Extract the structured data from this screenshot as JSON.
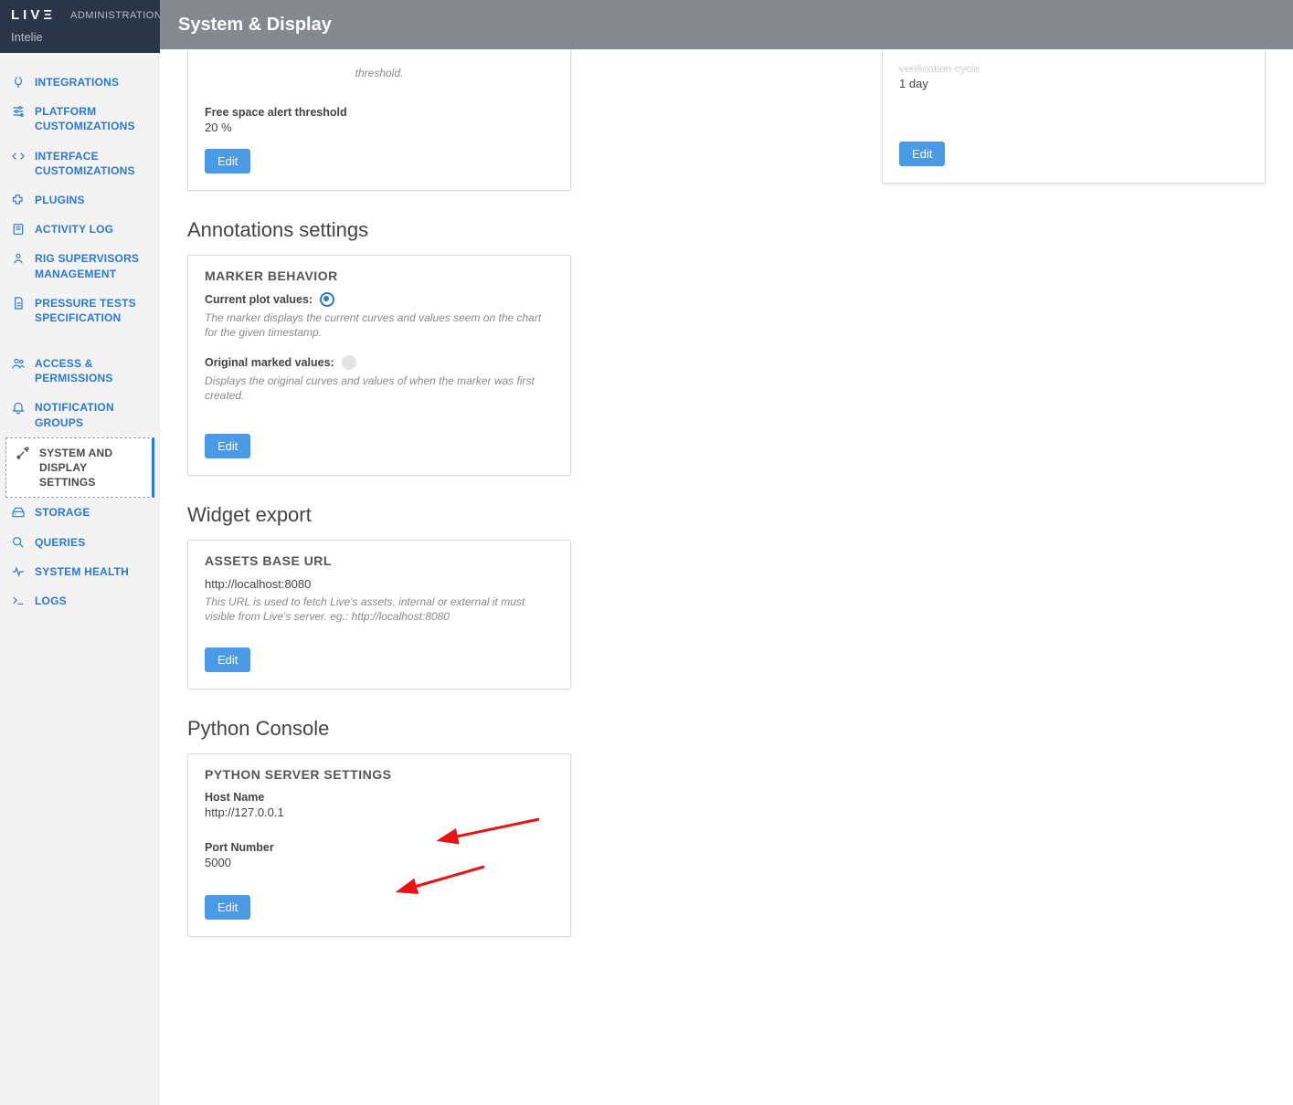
{
  "brand": {
    "logo": "LIVΞ",
    "admin": "ADMINISTRATION",
    "sub": "Intelie"
  },
  "topbar": {
    "title": "System & Display"
  },
  "sidebar": {
    "items": [
      {
        "key": "integrations",
        "label": "INTEGRATIONS"
      },
      {
        "key": "platform-customizations",
        "label": "PLATFORM CUSTOMIZATIONS"
      },
      {
        "key": "interface-customizations",
        "label": "INTERFACE CUSTOMIZATIONS"
      },
      {
        "key": "plugins",
        "label": "PLUGINS"
      },
      {
        "key": "activity-log",
        "label": "ACTIVITY LOG"
      },
      {
        "key": "rig-supervisors",
        "label": "RIG SUPERVISORS MANAGEMENT"
      },
      {
        "key": "pressure-tests",
        "label": "PRESSURE TESTS SPECIFICATION"
      }
    ],
    "items2": [
      {
        "key": "access-permissions",
        "label": "ACCESS & PERMISSIONS"
      },
      {
        "key": "notification-groups",
        "label": "NOTIFICATION GROUPS"
      },
      {
        "key": "system-display",
        "label": "SYSTEM AND DISPLAY SETTINGS"
      },
      {
        "key": "storage",
        "label": "STORAGE"
      },
      {
        "key": "queries",
        "label": "QUERIES"
      },
      {
        "key": "system-health",
        "label": "SYSTEM HEALTH"
      },
      {
        "key": "logs",
        "label": "LOGS"
      }
    ]
  },
  "cards": {
    "free_space": {
      "help_top": "threshold.",
      "label": "Free space alert threshold",
      "value": "20 %",
      "edit": "Edit"
    },
    "right_partial": {
      "label_cut": "verification cycle",
      "value": "1 day",
      "edit": "Edit"
    },
    "annotations": {
      "section": "Annotations settings",
      "title": "MARKER BEHAVIOR",
      "opt1_label": "Current plot values:",
      "opt1_help": "The marker displays the current curves and values seem on the chart for the given timestamp.",
      "opt2_label": "Original marked values:",
      "opt2_help": "Displays the original curves and values of when the marker was first created.",
      "edit": "Edit"
    },
    "widget_export": {
      "section": "Widget export",
      "title": "ASSETS BASE URL",
      "value": "http://localhost:8080",
      "help": "This URL is used to fetch Live's assets, internal or external it must visible from Live's server. eg.: http://localhost:8080",
      "edit": "Edit"
    },
    "python": {
      "section": "Python Console",
      "title": "PYTHON SERVER SETTINGS",
      "host_label": "Host Name",
      "host_value": "http://127.0.0.1",
      "port_label": "Port Number",
      "port_value": "5000",
      "edit": "Edit"
    }
  }
}
